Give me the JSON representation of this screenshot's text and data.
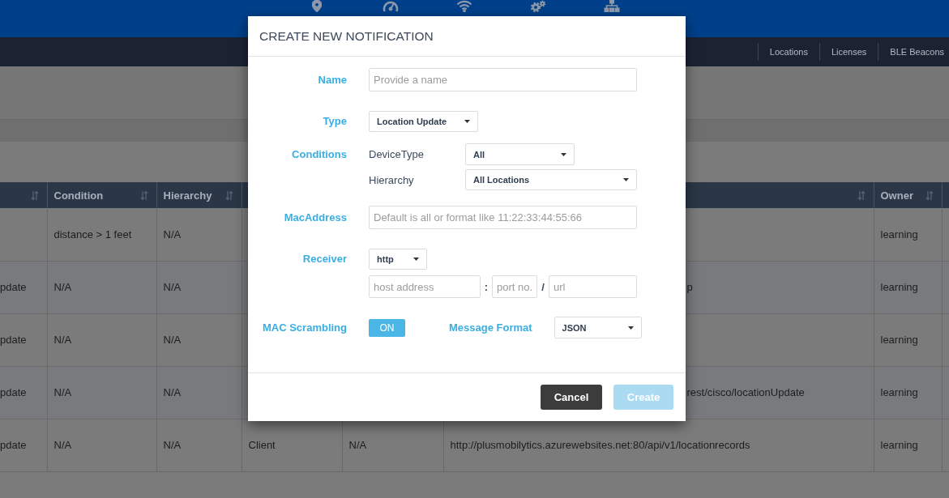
{
  "menu_links": [
    "Locations",
    "Licenses",
    "BLE Beacons"
  ],
  "table": {
    "headers": {
      "condition": "Condition",
      "hierarchy": "Hierarchy",
      "owner": "Owner"
    },
    "rows": [
      {
        "condition": "distance > 1 feet",
        "hierarchy": "N/A",
        "owner": "learning"
      },
      {
        "column_1": "pdate",
        "condition": "N/A",
        "hierarchy": "N/A",
        "column_6": "p",
        "owner": "learning"
      },
      {
        "column_1": "pdate",
        "condition": "N/A",
        "hierarchy": "N/A",
        "owner": "learning"
      },
      {
        "column_1": "pdate",
        "condition": "N/A",
        "hierarchy": "N/A",
        "column_6": "rest/cisco/locationUpdate",
        "owner": "learning"
      },
      {
        "column_1": "pdate",
        "condition": "N/A",
        "hierarchy": "N/A",
        "column_4": "Client",
        "column_5": "N/A",
        "column_6": "http://plusmobilytics.azurewebsites.net:80/api/v1/locationrecords",
        "owner": "learning"
      }
    ]
  },
  "dialog": {
    "title": "CREATE NEW NOTIFICATION",
    "name": {
      "label": "Name",
      "placeholder": "Provide a name"
    },
    "type": {
      "label": "Type",
      "value": "Location Update"
    },
    "conditions": {
      "label": "Conditions",
      "items": [
        {
          "label": "DeviceType",
          "value": "All"
        },
        {
          "label": "Hierarchy",
          "value": "All Locations"
        }
      ]
    },
    "mac_address": {
      "label": "MacAddress",
      "placeholder": "Default is all or format like 11:22:33:44:55:66"
    },
    "receiver": {
      "label": "Receiver",
      "protocol": "http",
      "host": {
        "placeholder": "host address"
      },
      "port_separator": ":",
      "port": {
        "placeholder": "port no."
      },
      "path_separator": "/",
      "url": {
        "placeholder": "url"
      }
    },
    "mac_scrambling": {
      "label": "MAC Scrambling",
      "toggle": {
        "label": "ON",
        "on": true
      }
    },
    "message_format": {
      "label": "Message Format",
      "value": "JSON"
    },
    "buttons": [
      {
        "label": "Cancel",
        "kind": "secondary",
        "disabled": false
      },
      {
        "label": "Create",
        "kind": "primary",
        "disabled": true
      }
    ]
  }
}
